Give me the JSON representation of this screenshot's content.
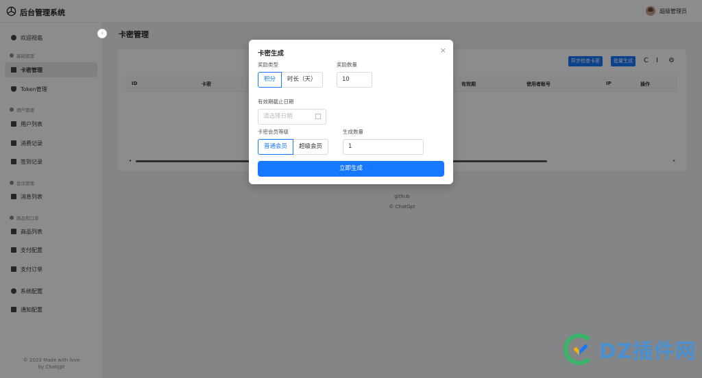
{
  "app": {
    "title": "后台管理系统",
    "user_name": "超级管理员"
  },
  "sidebar": {
    "collapse_icon": "‹",
    "items": [
      {
        "label": "欢迎视临",
        "type": "item"
      },
      {
        "label": "基础管理",
        "type": "group"
      },
      {
        "label": "卡密管理",
        "type": "item",
        "active": true
      },
      {
        "label": "Token管理",
        "type": "item"
      },
      {
        "label": "用户管理",
        "type": "group"
      },
      {
        "label": "用户列表",
        "type": "item"
      },
      {
        "label": "消费记录",
        "type": "item"
      },
      {
        "label": "签到记录",
        "type": "item"
      },
      {
        "label": "会话管理",
        "type": "group"
      },
      {
        "label": "消息列表",
        "type": "item"
      },
      {
        "label": "商品和订单",
        "type": "group"
      },
      {
        "label": "商品列表",
        "type": "item"
      },
      {
        "label": "支付配置",
        "type": "item"
      },
      {
        "label": "支付订单",
        "type": "item"
      },
      {
        "label": "系统配置",
        "type": "item"
      },
      {
        "label": "通知配置",
        "type": "item"
      }
    ],
    "footer_line1": "© 2023 Made with love",
    "footer_line2": "by Chatgpt"
  },
  "main": {
    "page_title": "卡密管理",
    "toolbar": {
      "check_label": "异步检查卡密",
      "batch_label": "批量生成",
      "refresh_icon": "C",
      "column_icon": "I",
      "settings_icon": "⚙"
    },
    "table": {
      "columns": [
        "ID",
        "卡密",
        "有效期",
        "使用者账号",
        "IP",
        "操作"
      ]
    },
    "footer_link": "github",
    "footer_copy": "© ChatGpt"
  },
  "modal": {
    "title": "卡密生成",
    "close_icon": "×",
    "reward_type_label": "奖励类型",
    "reward_type_options": [
      "积分",
      "时长（天）"
    ],
    "reward_type_selected": "积分",
    "reward_amount_label": "奖励数量",
    "reward_amount_value": "10",
    "expire_label": "有效期截止日期",
    "expire_placeholder": "请选择日期",
    "level_label": "卡密会员等级",
    "level_options": [
      "普通会员",
      "超级会员"
    ],
    "level_selected": "普通会员",
    "count_label": "生成数量",
    "count_value": "1",
    "submit_label": "立即生成"
  },
  "watermark": {
    "text": "DZ插件网"
  },
  "colors": {
    "primary": "#1677ff",
    "overlay": "rgba(0,0,0,0.45)"
  }
}
